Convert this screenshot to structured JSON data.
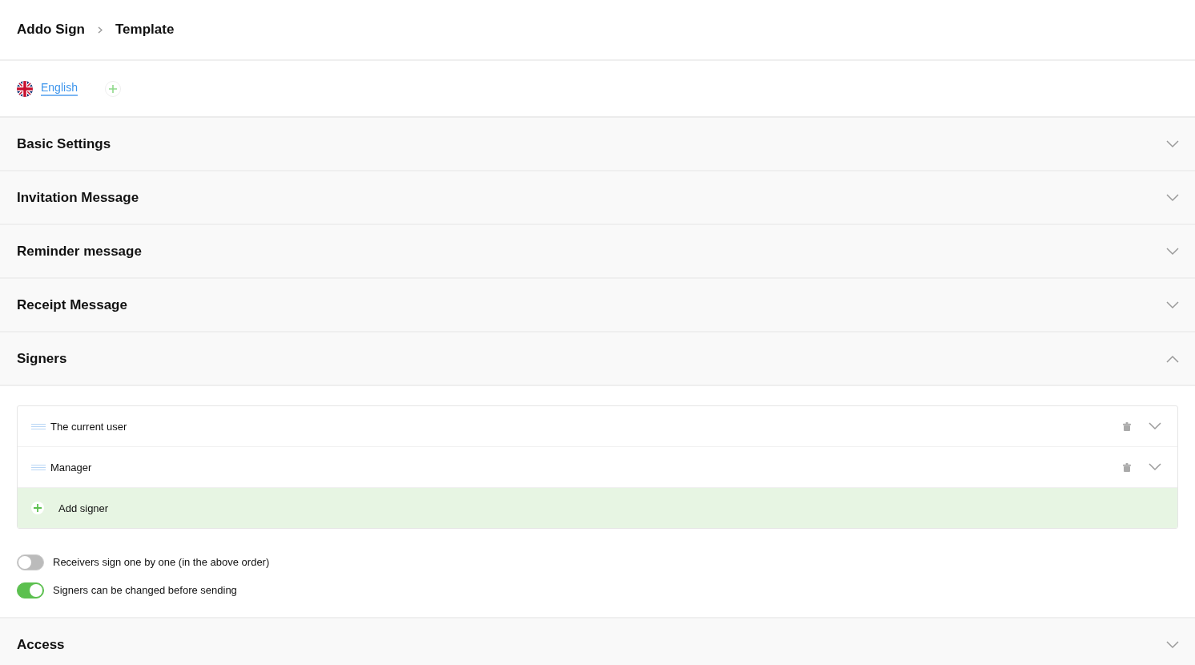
{
  "breadcrumb": [
    "Addo Sign",
    "Template"
  ],
  "languages": [
    {
      "label": "English",
      "selected": true
    }
  ],
  "sections": [
    {
      "title": "Basic Settings",
      "expanded": false
    },
    {
      "title": "Invitation Message",
      "expanded": false
    },
    {
      "title": "Reminder message",
      "expanded": false
    },
    {
      "title": "Receipt Message",
      "expanded": false
    },
    {
      "title": "Signers",
      "expanded": true,
      "kind": "signers",
      "signers": [
        {
          "name": "The current user",
          "expanded": false
        },
        {
          "name": "Manager",
          "expanded": false
        }
      ],
      "add_label": "Add signer",
      "toggles": [
        {
          "label": "Receivers sign one by one (in the above order)",
          "on": false
        },
        {
          "label": "Signers can be changed before sending",
          "on": true
        }
      ]
    },
    {
      "title": "Access",
      "expanded": false
    }
  ]
}
